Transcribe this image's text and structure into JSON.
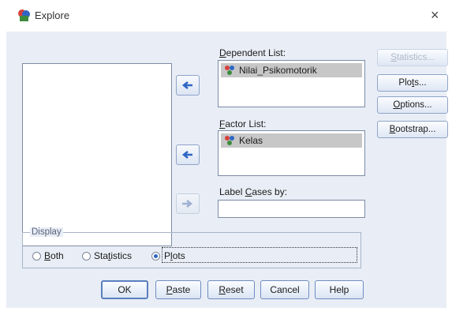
{
  "window": {
    "title": "Explore",
    "close_glyph": "×"
  },
  "dependent_list": {
    "label_pre": "",
    "label_key": "D",
    "label_post": "ependent List:",
    "items": [
      {
        "name": "Nilai_Psikomotorik",
        "icon": "nominal-variable-icon"
      }
    ]
  },
  "factor_list": {
    "label_pre": "",
    "label_key": "F",
    "label_post": "actor List:",
    "items": [
      {
        "name": "Kelas",
        "icon": "nominal-variable-icon"
      }
    ]
  },
  "label_cases": {
    "label_pre": "Label ",
    "label_key": "C",
    "label_post": "ases by:",
    "value": ""
  },
  "side_buttons": {
    "statistics": {
      "pre": "",
      "key": "S",
      "post": "tatistics..."
    },
    "plots": {
      "pre": "Plo",
      "key": "t",
      "post": "s..."
    },
    "options": {
      "pre": "",
      "key": "O",
      "post": "ptions..."
    },
    "bootstrap": {
      "pre": "",
      "key": "B",
      "post": "ootstrap..."
    }
  },
  "display": {
    "legend": "Display",
    "both": {
      "pre": "",
      "key": "B",
      "post": "oth",
      "selected": false
    },
    "statistics": {
      "pre": "Sta",
      "key": "t",
      "post": "istics",
      "selected": false
    },
    "plots": {
      "pre": "P",
      "key": "l",
      "post": "ots",
      "selected": true
    }
  },
  "bottom_buttons": {
    "ok": {
      "pre": "OK",
      "key": "",
      "post": ""
    },
    "paste": {
      "pre": "",
      "key": "P",
      "post": "aste"
    },
    "reset": {
      "pre": "",
      "key": "R",
      "post": "eset"
    },
    "cancel": {
      "pre": "Cancel",
      "key": "",
      "post": ""
    },
    "help": {
      "pre": "Help",
      "key": "",
      "post": ""
    }
  },
  "colors": {
    "accent": "#2f66c4",
    "dialog_bg": "#e9eef6",
    "selection": "#c7c7c7"
  }
}
